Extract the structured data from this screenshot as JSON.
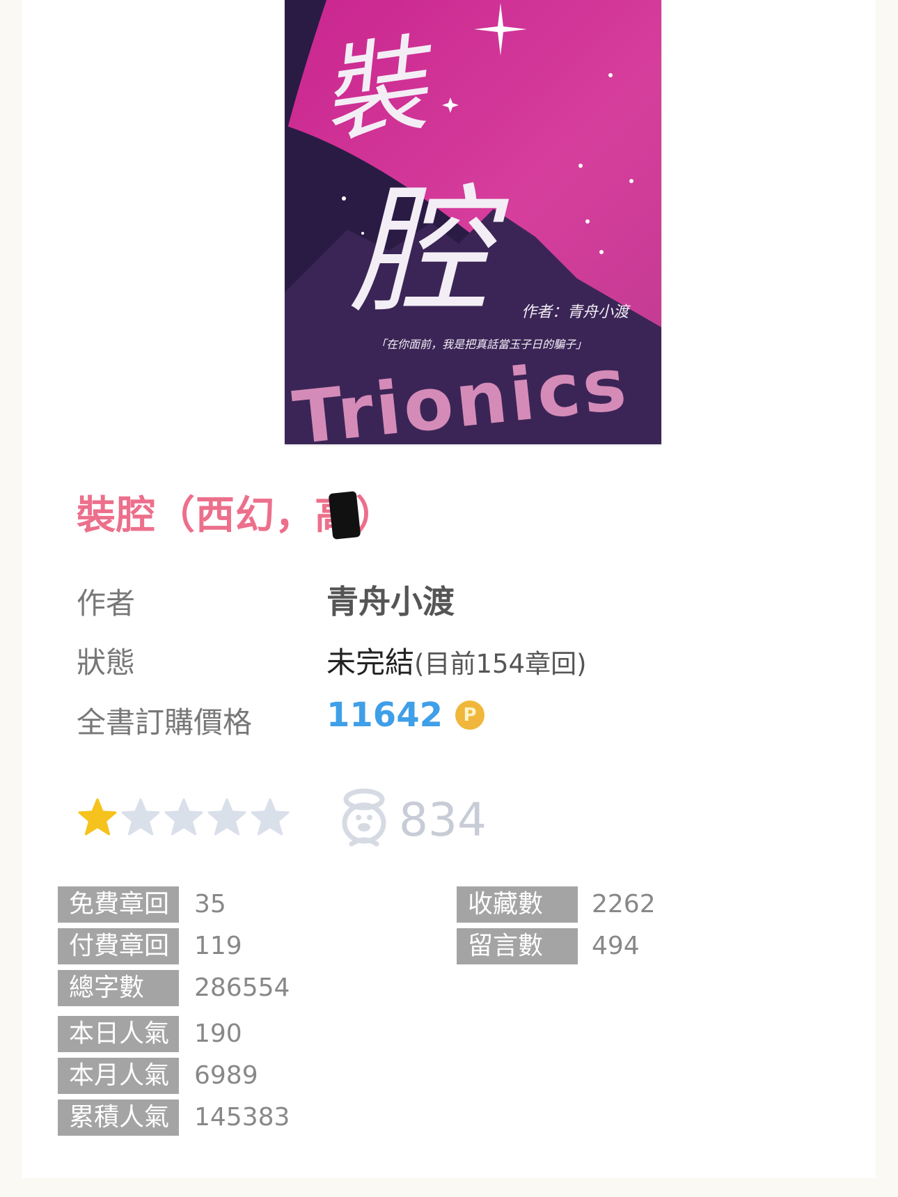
{
  "book": {
    "title_text": "裝腔（西幻，高",
    "title_close": "）"
  },
  "info": {
    "author_label": "作者",
    "author_value": "青舟小渡",
    "status_label": "狀態",
    "status_value": "未完結",
    "status_detail": "(目前154章回)",
    "price_label": "全書訂購價格",
    "price_value": "11642",
    "coin_symbol": "P"
  },
  "rating": {
    "stars_filled": 1,
    "stars_total": 5,
    "favorites_count": "834"
  },
  "stats_left": [
    {
      "label": "免費章回",
      "value": "35"
    },
    {
      "label": "付費章回",
      "value": "119"
    },
    {
      "label": "總字數",
      "value": "286554"
    },
    {
      "label": "本日人氣",
      "value": "190"
    },
    {
      "label": "本月人氣",
      "value": "6989"
    },
    {
      "label": "累積人氣",
      "value": "145383"
    }
  ],
  "stats_right": [
    {
      "label": "收藏數",
      "value": "2262"
    },
    {
      "label": "留言數",
      "value": "494"
    }
  ],
  "colors": {
    "title": "#ec6f8b",
    "price": "#3f9fe8",
    "star_filled": "#f6c21d",
    "star_empty": "#d9e0ea",
    "stat_label_bg": "#a4a4a4"
  },
  "cover": {
    "title_chars": "裝腔",
    "subtitle": "Trionics",
    "author_line": "作者：青舟小渡",
    "tagline": "「在你面前，我是把真話當玉子日的騙子」"
  }
}
